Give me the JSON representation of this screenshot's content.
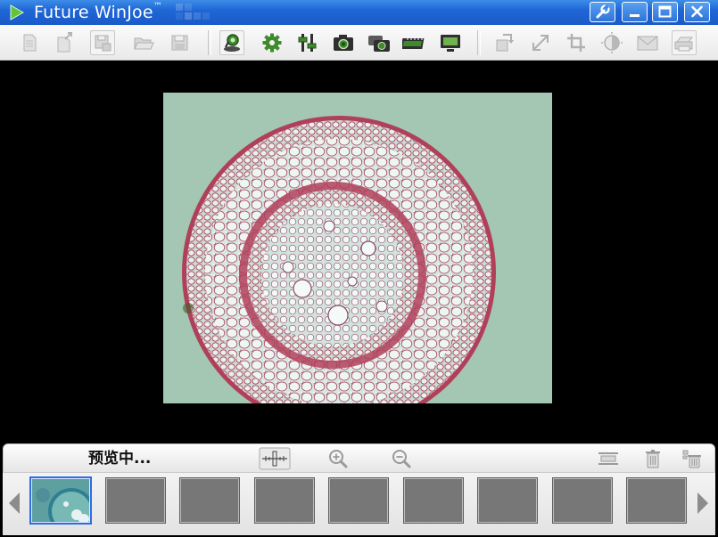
{
  "window": {
    "title": "Future WinJoe",
    "title_mark": "™",
    "title_bar_color": "#1f66d6"
  },
  "title_buttons": [
    {
      "name": "settings-wrench-icon"
    },
    {
      "name": "minimize-icon"
    },
    {
      "name": "maximize-icon"
    },
    {
      "name": "close-icon"
    }
  ],
  "toolbar": {
    "icons": [
      {
        "name": "new-file-icon",
        "enabled": false
      },
      {
        "name": "export-file-icon",
        "enabled": false
      },
      {
        "name": "save-as-icon",
        "enabled": false
      },
      {
        "name": "open-folder-icon",
        "enabled": false
      },
      {
        "name": "save-icon",
        "enabled": false
      },
      {
        "name": "camera-preview-icon",
        "enabled": true
      },
      {
        "name": "gear-icon",
        "enabled": true
      },
      {
        "name": "sliders-icon",
        "enabled": true
      },
      {
        "name": "capture-photo-icon",
        "enabled": true
      },
      {
        "name": "burst-capture-icon",
        "enabled": true
      },
      {
        "name": "record-video-icon",
        "enabled": true
      },
      {
        "name": "display-monitor-icon",
        "enabled": true
      },
      {
        "name": "rotate-icon",
        "enabled": false
      },
      {
        "name": "resize-icon",
        "enabled": false
      },
      {
        "name": "crop-icon",
        "enabled": false
      },
      {
        "name": "brightness-icon",
        "enabled": false
      },
      {
        "name": "email-icon",
        "enabled": false
      },
      {
        "name": "print-icon",
        "enabled": false
      }
    ]
  },
  "preview": {
    "background": "#000000",
    "specimen_background": "#9ec3ad",
    "stain_color": "#b0405a"
  },
  "status": {
    "text": "预览中..."
  },
  "status_icons": [
    {
      "name": "measure-ruler-icon"
    },
    {
      "name": "zoom-in-icon"
    },
    {
      "name": "zoom-out-icon"
    },
    {
      "name": "fit-width-icon"
    },
    {
      "name": "delete-icon"
    },
    {
      "name": "delete-all-icon"
    }
  ],
  "thumbnails": {
    "count": 9,
    "active_index": 0,
    "accent": "#2d6fe0"
  }
}
